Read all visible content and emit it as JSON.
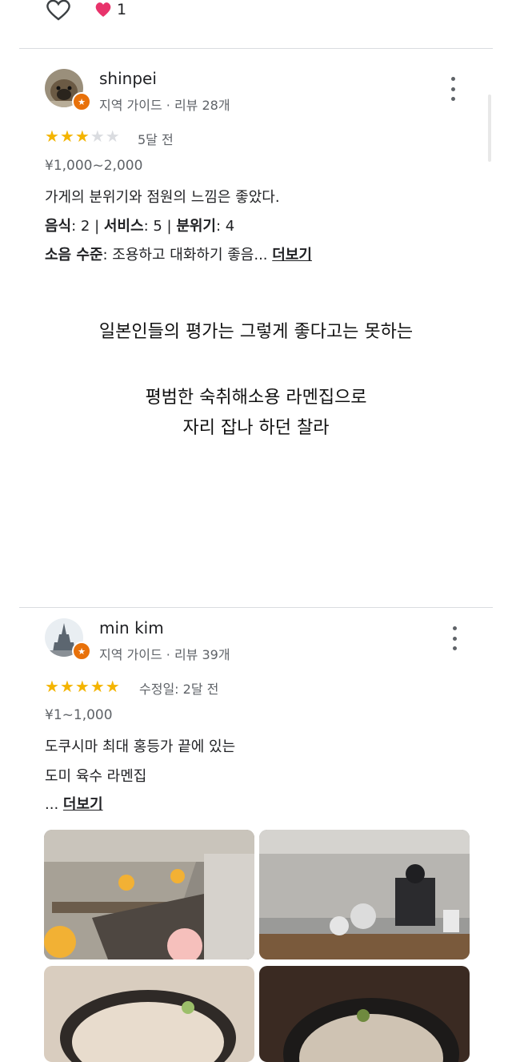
{
  "top_bar": {
    "like_count": "1"
  },
  "reviews": [
    {
      "name": "shinpei",
      "meta": "지역 가이드 · 리뷰 28개",
      "rating": 3,
      "time": "5달 전",
      "price": "¥1,000~2,000",
      "text": "가게의 분위기와 점원의 느낌은 좋았다.",
      "scores": {
        "food_label": "음식",
        "food_value": ": 2 | ",
        "service_label": "서비스",
        "service_value": ": 5 | ",
        "atmosphere_label": "분위기",
        "atmosphere_value": ": 4"
      },
      "noise_label": "소음 수준",
      "noise_value": ": 조용하고 대화하기 좋음...",
      "more": "더보기"
    },
    {
      "name": "min kim",
      "meta": "지역 가이드 · 리뷰 39개",
      "rating": 5,
      "time": "수정일: 2달 전",
      "price": "¥1~1,000",
      "text_line1": "도쿠시마 최대 홍등가 끝에 있는",
      "text_line2": "도미 육수 라멘집",
      "ellipsis": "... ",
      "more": "더보기"
    }
  ],
  "caption": {
    "line1": "일본인들의 평가는 그렇게 좋다고는 못하는",
    "line2": "평범한 숙취해소용 라멘집으로",
    "line3": "자리 잡나 하던 찰라"
  },
  "colors": {
    "star": "#f4b400",
    "badge": "#e8710a",
    "heart": "#e8336b"
  },
  "icons": [
    "heart-outline-icon",
    "heart-filled-icon",
    "local-guide-badge-icon",
    "more-vert-icon",
    "star-icon"
  ]
}
